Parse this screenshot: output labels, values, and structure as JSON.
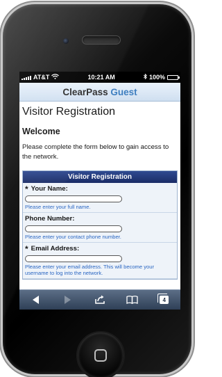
{
  "status_bar": {
    "carrier": "AT&T",
    "time": "10:21 AM",
    "battery": "100%",
    "battery_level": 1.0
  },
  "header": {
    "brand_primary": "ClearPass",
    "brand_secondary": "Guest",
    "accent_color": "#3f7fc0"
  },
  "page": {
    "title": "Visitor Registration",
    "welcome": "Welcome",
    "intro": "Please complete the form below to gain access to the network."
  },
  "form": {
    "header": "Visitor Registration",
    "header_color": "#1a2c66",
    "fields": [
      {
        "label": "Your Name:",
        "required_mark": "*",
        "hint": "Please enter your full name."
      },
      {
        "label": "Phone Number:",
        "required_mark": "",
        "hint": "Please enter your contact phone number."
      },
      {
        "label": "Email Address:",
        "required_mark": "*",
        "hint": "Please enter your email address. This will become your username to log into the network."
      }
    ]
  },
  "toolbar": {
    "icons": [
      "back-arrow-icon",
      "forward-arrow-icon",
      "share-icon",
      "bookmarks-icon",
      "pages-icon"
    ],
    "tab_count": "4"
  }
}
